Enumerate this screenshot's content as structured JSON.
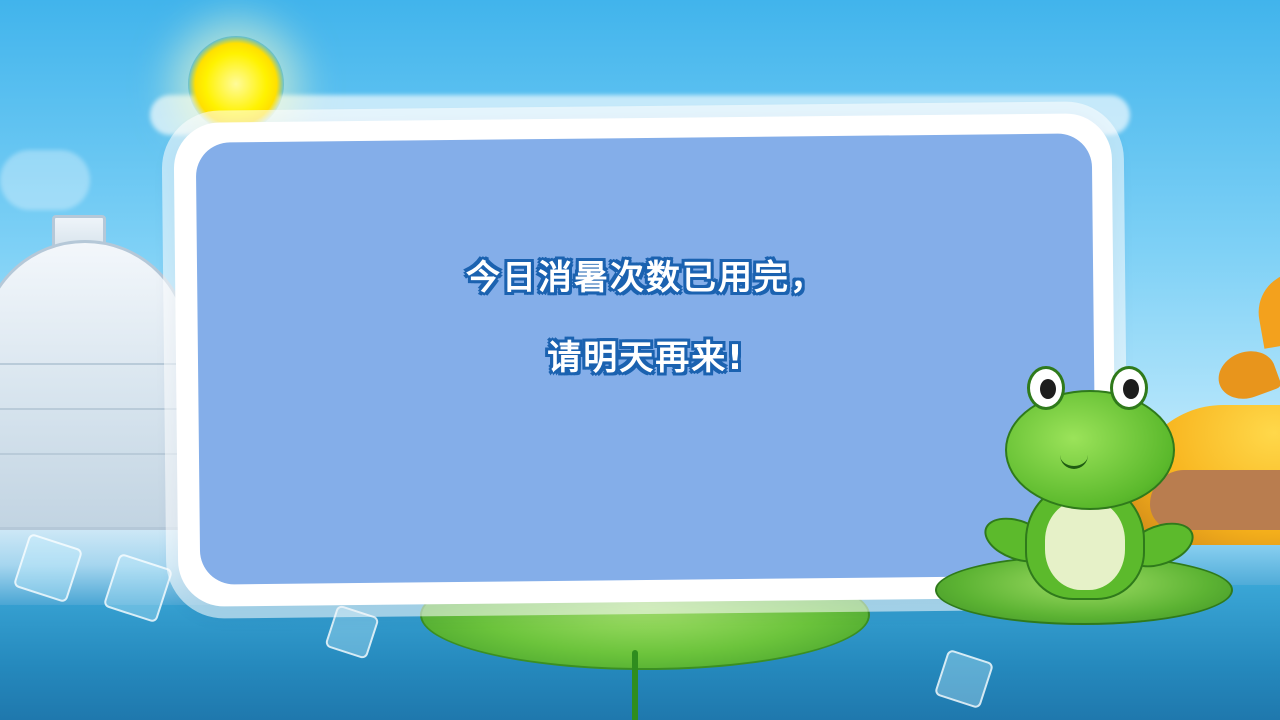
{
  "dialog": {
    "line1": "今日消暑次数已用完，",
    "line2": "请明天再来!"
  },
  "colors": {
    "panel_fill": "#84aee9",
    "panel_border": "#ffffff",
    "text_fill": "#ffffff",
    "text_outline": "#1b62b0"
  },
  "icons": {
    "sun": "sun-icon",
    "frog": "frog-icon",
    "igloo": "igloo-icon",
    "lily_pad": "lily-pad-icon"
  }
}
